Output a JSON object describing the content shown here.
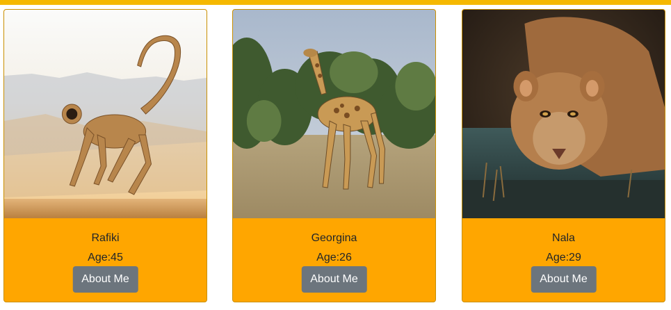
{
  "colors": {
    "top_bar": "#f5b800",
    "card_background": "#ffa600",
    "card_border": "#c98f00",
    "button_background": "#6c757d",
    "button_text": "#ffffff"
  },
  "cards": [
    {
      "image": "monkey-photo",
      "name": "Rafiki",
      "age_text": "Age:45",
      "button_label": "About Me"
    },
    {
      "image": "giraffe-photo",
      "name": "Georgina",
      "age_text": "Age:26",
      "button_label": "About Me"
    },
    {
      "image": "lioness-photo",
      "name": "Nala",
      "age_text": "Age:29",
      "button_label": "About Me"
    }
  ]
}
